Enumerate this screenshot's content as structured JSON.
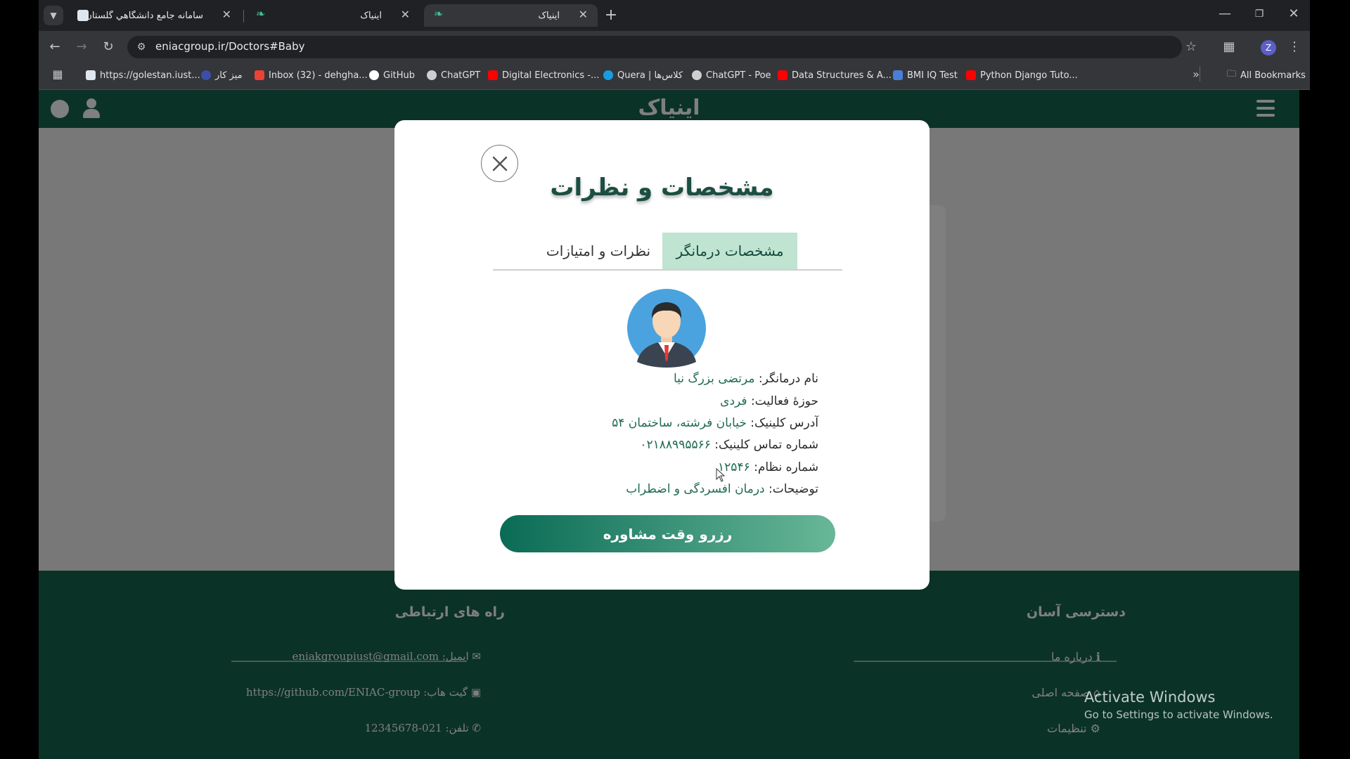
{
  "browser": {
    "tabs": [
      {
        "title": "سامانه جامع دانشگاهي گلستان -",
        "active": false
      },
      {
        "title": "اینیاک",
        "active": false
      },
      {
        "title": "اینیاک",
        "active": true
      }
    ],
    "url": "eniacgroup.ir/Doctors#Baby",
    "profile_initial": "Z",
    "bookmarks": [
      {
        "label": "https://golestan.iust...",
        "icon": "site-icon"
      },
      {
        "label": "میز کار",
        "icon": "site-icon"
      },
      {
        "label": "Inbox (32) - dehgha...",
        "icon": "gmail-icon"
      },
      {
        "label": "GitHub",
        "icon": "github-icon"
      },
      {
        "label": "ChatGPT",
        "icon": "chatgpt-icon"
      },
      {
        "label": "Digital Electronics -...",
        "icon": "youtube-icon"
      },
      {
        "label": "Quera | کلاس‌ها",
        "icon": "quera-icon"
      },
      {
        "label": "ChatGPT - Poe",
        "icon": "poe-icon"
      },
      {
        "label": "Data Structures & A...",
        "icon": "youtube-icon"
      },
      {
        "label": "BMI IQ Test",
        "icon": "site-icon"
      },
      {
        "label": "Python Django Tuto...",
        "icon": "youtube-icon"
      }
    ],
    "all_bookmarks": "All Bookmarks"
  },
  "site": {
    "logo": "اینیاک"
  },
  "modal": {
    "title": "مشخصات و نظرات",
    "tab_specs": "مشخصات درمانگر",
    "tab_reviews": "نظرات و امتیازات",
    "fields": [
      {
        "label": "نام درمانگر:",
        "value": "مرتضی بزرگ نیا"
      },
      {
        "label": "حوزهٔ فعالیت:",
        "value": "فردی"
      },
      {
        "label": "آدرس کلینیک:",
        "value": "خیابان فرشته، ساختمان ۵۴"
      },
      {
        "label": "شماره تماس کلینیک:",
        "value": "۰۲۱۸۸۹۹۵۵۶۶"
      },
      {
        "label": "شماره نظام:",
        "value": "۱۲۵۴۶"
      },
      {
        "label": "توضیحات:",
        "value": "درمان افسردگی و اضطراب"
      }
    ],
    "reserve_button": "رزرو وقت مشاوره"
  },
  "footer": {
    "contact_title": "راه های ارتباطی",
    "contact": {
      "email": "ایمیل: eniakgroupiust@gmail.com",
      "github": "گیت هاب: https://github.com/ENIAC-group",
      "phone": "تلفن: 021-12345678"
    },
    "quick_title": "دسترسی آسان",
    "quick": {
      "about": "درباره ما",
      "home": "صفحه اصلی",
      "settings": "تنظیمات"
    }
  },
  "os": {
    "watermark_title": "Activate Windows",
    "watermark_sub": "Go to Settings to activate Windows."
  }
}
